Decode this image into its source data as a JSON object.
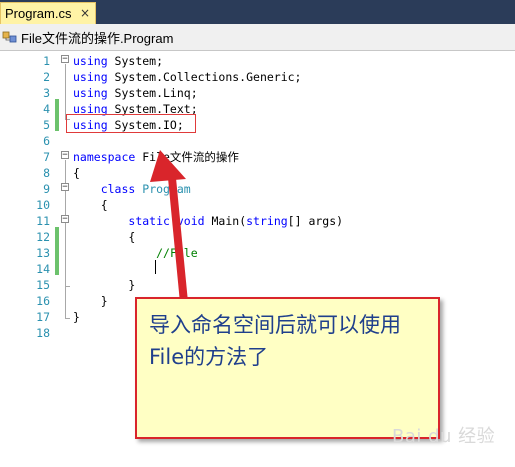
{
  "tab": {
    "label": "Program.cs",
    "close_glyph": "×"
  },
  "navbar": {
    "icon": "csharp-class-icon",
    "label": "File文件流的操作.Program"
  },
  "editor": {
    "line_numbers": [
      "1",
      "2",
      "3",
      "4",
      "5",
      "6",
      "7",
      "8",
      "9",
      "10",
      "11",
      "12",
      "13",
      "14",
      "15",
      "16",
      "17",
      "18"
    ],
    "lines": [
      {
        "parts": [
          {
            "t": "using",
            "c": "kw"
          },
          {
            "t": " System;",
            "c": ""
          }
        ]
      },
      {
        "parts": [
          {
            "t": "using",
            "c": "kw"
          },
          {
            "t": " System.Collections.Generic;",
            "c": ""
          }
        ]
      },
      {
        "parts": [
          {
            "t": "using",
            "c": "kw"
          },
          {
            "t": " System.Linq;",
            "c": ""
          }
        ]
      },
      {
        "parts": [
          {
            "t": "using",
            "c": "kw"
          },
          {
            "t": " System.Text;",
            "c": ""
          }
        ]
      },
      {
        "parts": [
          {
            "t": "using",
            "c": "kw"
          },
          {
            "t": " System.IO;",
            "c": ""
          }
        ]
      },
      {
        "parts": []
      },
      {
        "parts": [
          {
            "t": "namespace",
            "c": "kw"
          },
          {
            "t": " File文件流的操作",
            "c": ""
          }
        ]
      },
      {
        "parts": [
          {
            "t": "{",
            "c": ""
          }
        ]
      },
      {
        "parts": [
          {
            "t": "    ",
            "c": ""
          },
          {
            "t": "class",
            "c": "kw"
          },
          {
            "t": " ",
            "c": ""
          },
          {
            "t": "Program",
            "c": "type"
          }
        ]
      },
      {
        "parts": [
          {
            "t": "    {",
            "c": ""
          }
        ]
      },
      {
        "parts": [
          {
            "t": "        ",
            "c": ""
          },
          {
            "t": "static",
            "c": "kw"
          },
          {
            "t": " ",
            "c": ""
          },
          {
            "t": "void",
            "c": "kw"
          },
          {
            "t": " Main(",
            "c": ""
          },
          {
            "t": "string",
            "c": "kw"
          },
          {
            "t": "[] args)",
            "c": ""
          }
        ]
      },
      {
        "parts": [
          {
            "t": "        {",
            "c": ""
          }
        ]
      },
      {
        "parts": [
          {
            "t": "            ",
            "c": ""
          },
          {
            "t": "//File",
            "c": "comment"
          }
        ]
      },
      {
        "parts": []
      },
      {
        "parts": [
          {
            "t": "        }",
            "c": ""
          }
        ]
      },
      {
        "parts": [
          {
            "t": "    }",
            "c": ""
          }
        ]
      },
      {
        "parts": [
          {
            "t": "}",
            "c": ""
          }
        ]
      },
      {
        "parts": []
      }
    ]
  },
  "callout": {
    "text": "导入命名空间后就可以使用File的方法了"
  },
  "watermark": {
    "text": "Bai du 经验"
  },
  "colors": {
    "keyword": "#0000ff",
    "type": "#2b91af",
    "comment": "#008000",
    "line_number": "#2b91af",
    "change_mark": "#6cc26c",
    "annotation_red": "#d9252b",
    "callout_bg": "#ffffc4",
    "callout_text": "#1f3f8c"
  }
}
